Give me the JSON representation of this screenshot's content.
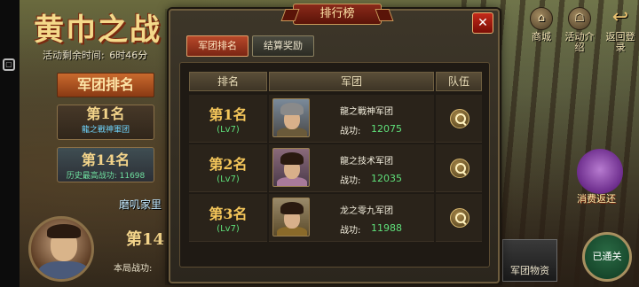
{
  "event": {
    "title": "黄巾之战",
    "remaining_label": "活动剩余时间:",
    "remaining_time": "6时46分",
    "rank_banner": "军团排名",
    "my_rank_first": "第1名",
    "my_rank_first_guild": "龍之戰神軍团",
    "my_rank": "第14名",
    "history_best": "历史最高战功: 11698",
    "guild_link": "磨叽家里",
    "partial_rank": "第14",
    "battle_score_label": "本局战功:"
  },
  "side_buttons": {
    "shop": "商城",
    "activity": "活动介绍",
    "return": "返回登录"
  },
  "bottom_buttons": {
    "gift": "消费返还",
    "supply": "军团物资",
    "cleared": "已通关"
  },
  "modal": {
    "title": "排行榜",
    "close": "✕",
    "tabs": [
      "军团排名",
      "结算奖励"
    ],
    "columns": [
      "排名",
      "军团",
      "队伍"
    ],
    "rows": [
      {
        "rank": "第1名",
        "level": "(Lv7)",
        "guild": "龍之戰神军团",
        "power_label": "战功:",
        "power": "12075",
        "portrait": "helmeted-general-portrait"
      },
      {
        "rank": "第2名",
        "level": "(Lv7)",
        "guild": "龍之技术军团",
        "power_label": "战功:",
        "power": "12035",
        "portrait": "female-portrait"
      },
      {
        "rank": "第3名",
        "level": "(Lv7)",
        "guild": "龙之零九军团",
        "power_label": "战功:",
        "power": "11988",
        "portrait": "scholar-general-portrait"
      }
    ]
  }
}
